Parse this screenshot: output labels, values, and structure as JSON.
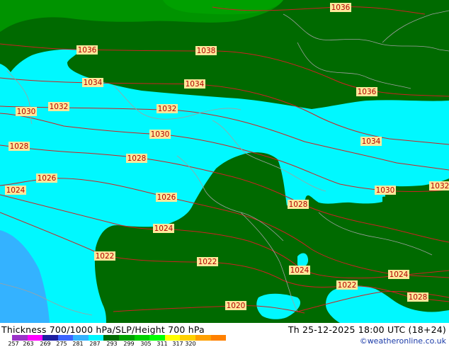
{
  "map": {
    "colors": {
      "cyan": "#00f8ff",
      "dark_green": "#006a00",
      "mid_green": "#009300",
      "light_blue": "#34b2ff",
      "isobar": "#cc2222",
      "border": "#a0a0a0"
    },
    "isobar_labels": [
      "1036",
      "1036",
      "1038",
      "1034",
      "1034",
      "1036",
      "1030",
      "1032",
      "1032",
      "1030",
      "1034",
      "1028",
      "1028",
      "1026",
      "1024",
      "1026",
      "1030",
      "1032",
      "1028",
      "1024",
      "1022",
      "1022",
      "1024",
      "1024",
      "1022",
      "1020",
      "1028"
    ]
  },
  "footer": {
    "title": "Thickness 700/1000 hPa/SLP/Height 700 hPa",
    "datetime": "Th 25-12-2025 18:00 UTC (18+24)",
    "credit": "©weatheronline.co.uk",
    "colorbar_colors": [
      "#9a32c8",
      "#ff00ff",
      "#1e1ea0",
      "#3c64ff",
      "#34b2ff",
      "#00f8ff",
      "#006a00",
      "#00a000",
      "#00d000",
      "#00ff00",
      "#ffff00",
      "#ffd000",
      "#ffa000",
      "#ff8000"
    ],
    "ticks": [
      "257",
      "263",
      "269",
      "275",
      "281",
      "287",
      "293",
      "299",
      "305",
      "311",
      "317",
      "320"
    ]
  }
}
